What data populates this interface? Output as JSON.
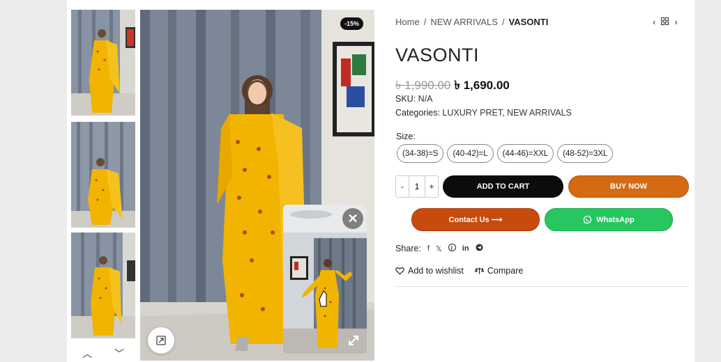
{
  "breadcrumb": {
    "home": "Home",
    "category": "NEW ARRIVALS",
    "current": "VASONTI",
    "sep": "/"
  },
  "product": {
    "title": "VASONTI",
    "old_price": "৳ 1,990.00",
    "new_price": "৳ 1,690.00",
    "discount_badge": "-15%",
    "sku_label": "SKU:",
    "sku_value": "N/A",
    "categories_label": "Categories:",
    "categories_value": "LUXURY PRET, NEW ARRIVALS"
  },
  "size": {
    "label": "Size:",
    "options": [
      "(34-38)=S",
      "(40-42)=L",
      "(44-46)=XXL",
      "(48-52)=3XL"
    ]
  },
  "quantity": {
    "minus": "-",
    "value": "1",
    "plus": "+"
  },
  "buttons": {
    "add_to_cart": "ADD TO CART",
    "buy_now": "BUY NOW",
    "contact_us": "Contact Us ⟶",
    "whatsapp": "WhatsApp"
  },
  "share": {
    "label": "Share:"
  },
  "actions": {
    "wishlist": "Add to wishlist",
    "compare": "Compare"
  },
  "colors": {
    "cart": "#0c0c0c",
    "buy": "#d46a12",
    "contact": "#c74b0c",
    "whatsapp": "#27c760",
    "dress": "#f1b400"
  }
}
